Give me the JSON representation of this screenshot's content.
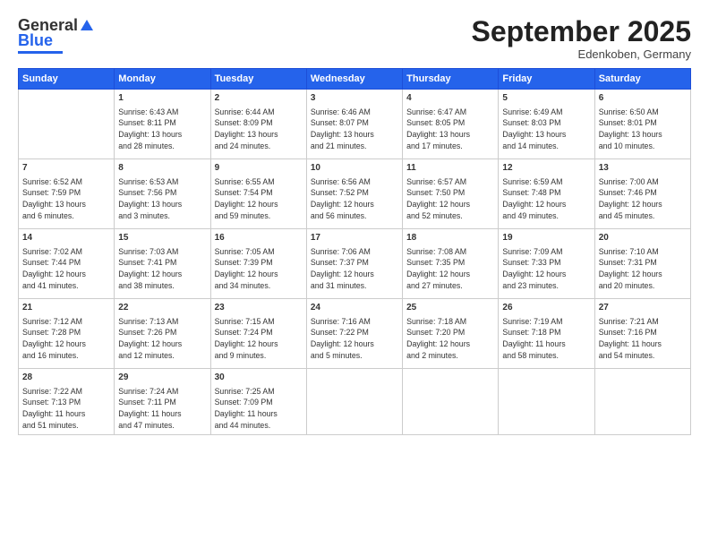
{
  "logo": {
    "general": "General",
    "blue": "Blue"
  },
  "title": "September 2025",
  "subtitle": "Edenkoben, Germany",
  "headers": [
    "Sunday",
    "Monday",
    "Tuesday",
    "Wednesday",
    "Thursday",
    "Friday",
    "Saturday"
  ],
  "weeks": [
    [
      {
        "day": "",
        "info": ""
      },
      {
        "day": "1",
        "info": "Sunrise: 6:43 AM\nSunset: 8:11 PM\nDaylight: 13 hours\nand 28 minutes."
      },
      {
        "day": "2",
        "info": "Sunrise: 6:44 AM\nSunset: 8:09 PM\nDaylight: 13 hours\nand 24 minutes."
      },
      {
        "day": "3",
        "info": "Sunrise: 6:46 AM\nSunset: 8:07 PM\nDaylight: 13 hours\nand 21 minutes."
      },
      {
        "day": "4",
        "info": "Sunrise: 6:47 AM\nSunset: 8:05 PM\nDaylight: 13 hours\nand 17 minutes."
      },
      {
        "day": "5",
        "info": "Sunrise: 6:49 AM\nSunset: 8:03 PM\nDaylight: 13 hours\nand 14 minutes."
      },
      {
        "day": "6",
        "info": "Sunrise: 6:50 AM\nSunset: 8:01 PM\nDaylight: 13 hours\nand 10 minutes."
      }
    ],
    [
      {
        "day": "7",
        "info": "Sunrise: 6:52 AM\nSunset: 7:59 PM\nDaylight: 13 hours\nand 6 minutes."
      },
      {
        "day": "8",
        "info": "Sunrise: 6:53 AM\nSunset: 7:56 PM\nDaylight: 13 hours\nand 3 minutes."
      },
      {
        "day": "9",
        "info": "Sunrise: 6:55 AM\nSunset: 7:54 PM\nDaylight: 12 hours\nand 59 minutes."
      },
      {
        "day": "10",
        "info": "Sunrise: 6:56 AM\nSunset: 7:52 PM\nDaylight: 12 hours\nand 56 minutes."
      },
      {
        "day": "11",
        "info": "Sunrise: 6:57 AM\nSunset: 7:50 PM\nDaylight: 12 hours\nand 52 minutes."
      },
      {
        "day": "12",
        "info": "Sunrise: 6:59 AM\nSunset: 7:48 PM\nDaylight: 12 hours\nand 49 minutes."
      },
      {
        "day": "13",
        "info": "Sunrise: 7:00 AM\nSunset: 7:46 PM\nDaylight: 12 hours\nand 45 minutes."
      }
    ],
    [
      {
        "day": "14",
        "info": "Sunrise: 7:02 AM\nSunset: 7:44 PM\nDaylight: 12 hours\nand 41 minutes."
      },
      {
        "day": "15",
        "info": "Sunrise: 7:03 AM\nSunset: 7:41 PM\nDaylight: 12 hours\nand 38 minutes."
      },
      {
        "day": "16",
        "info": "Sunrise: 7:05 AM\nSunset: 7:39 PM\nDaylight: 12 hours\nand 34 minutes."
      },
      {
        "day": "17",
        "info": "Sunrise: 7:06 AM\nSunset: 7:37 PM\nDaylight: 12 hours\nand 31 minutes."
      },
      {
        "day": "18",
        "info": "Sunrise: 7:08 AM\nSunset: 7:35 PM\nDaylight: 12 hours\nand 27 minutes."
      },
      {
        "day": "19",
        "info": "Sunrise: 7:09 AM\nSunset: 7:33 PM\nDaylight: 12 hours\nand 23 minutes."
      },
      {
        "day": "20",
        "info": "Sunrise: 7:10 AM\nSunset: 7:31 PM\nDaylight: 12 hours\nand 20 minutes."
      }
    ],
    [
      {
        "day": "21",
        "info": "Sunrise: 7:12 AM\nSunset: 7:28 PM\nDaylight: 12 hours\nand 16 minutes."
      },
      {
        "day": "22",
        "info": "Sunrise: 7:13 AM\nSunset: 7:26 PM\nDaylight: 12 hours\nand 12 minutes."
      },
      {
        "day": "23",
        "info": "Sunrise: 7:15 AM\nSunset: 7:24 PM\nDaylight: 12 hours\nand 9 minutes."
      },
      {
        "day": "24",
        "info": "Sunrise: 7:16 AM\nSunset: 7:22 PM\nDaylight: 12 hours\nand 5 minutes."
      },
      {
        "day": "25",
        "info": "Sunrise: 7:18 AM\nSunset: 7:20 PM\nDaylight: 12 hours\nand 2 minutes."
      },
      {
        "day": "26",
        "info": "Sunrise: 7:19 AM\nSunset: 7:18 PM\nDaylight: 11 hours\nand 58 minutes."
      },
      {
        "day": "27",
        "info": "Sunrise: 7:21 AM\nSunset: 7:16 PM\nDaylight: 11 hours\nand 54 minutes."
      }
    ],
    [
      {
        "day": "28",
        "info": "Sunrise: 7:22 AM\nSunset: 7:13 PM\nDaylight: 11 hours\nand 51 minutes."
      },
      {
        "day": "29",
        "info": "Sunrise: 7:24 AM\nSunset: 7:11 PM\nDaylight: 11 hours\nand 47 minutes."
      },
      {
        "day": "30",
        "info": "Sunrise: 7:25 AM\nSunset: 7:09 PM\nDaylight: 11 hours\nand 44 minutes."
      },
      {
        "day": "",
        "info": ""
      },
      {
        "day": "",
        "info": ""
      },
      {
        "day": "",
        "info": ""
      },
      {
        "day": "",
        "info": ""
      }
    ]
  ]
}
